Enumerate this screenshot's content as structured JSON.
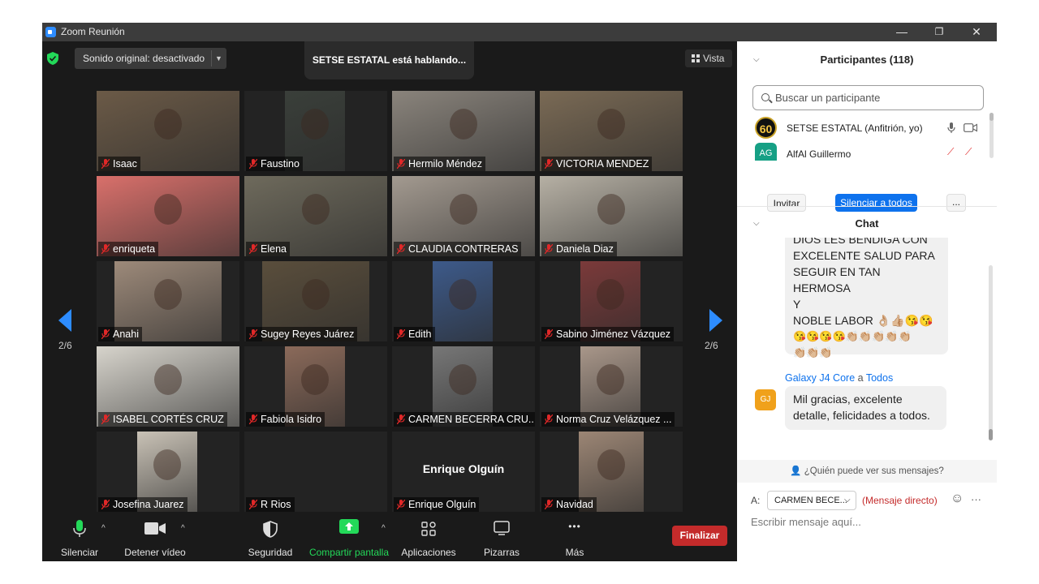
{
  "window": {
    "title": "Zoom Reunión",
    "minimize": "—",
    "restore": "❐",
    "close": "✕"
  },
  "topbar": {
    "sound": "Sonido original: desactivado",
    "speaking": "SETSE ESTATAL está hablando...",
    "view": "Vista"
  },
  "gallery": {
    "page_left": "2/6",
    "page_right": "2/6",
    "tiles": [
      {
        "name": "Isaac",
        "bg": "#6b5a47"
      },
      {
        "name": "Faustino",
        "bg": "#3a3f3a"
      },
      {
        "name": "Hermilo Méndez",
        "bg": "#8a847c"
      },
      {
        "name": "VICTORIA MENDEZ",
        "bg": "#7a6a55"
      },
      {
        "name": "enriqueta",
        "bg": "#d9706b"
      },
      {
        "name": "Elena",
        "bg": "#6e6a5c"
      },
      {
        "name": "CLAUDIA CONTRERAS",
        "bg": "#a39a90"
      },
      {
        "name": "Daniela Diaz",
        "bg": "#b6b0a4"
      },
      {
        "name": "Anahi",
        "bg": "#9d8a7a"
      },
      {
        "name": "Sugey Reyes Juárez",
        "bg": "#5a4e3c"
      },
      {
        "name": "Edith",
        "bg": "#3d5a8a"
      },
      {
        "name": "Sabino Jiménez Vázquez",
        "bg": "#7b3a3a"
      },
      {
        "name": "ISABEL CORTÉS CRUZ",
        "bg": "#d7d4cc"
      },
      {
        "name": "Fabiola Isidro",
        "bg": "#8b6a5a"
      },
      {
        "name": "CARMEN BECERRA CRU...",
        "bg": "#777"
      },
      {
        "name": "Norma Cruz Velázquez ...",
        "bg": "#a9978a"
      },
      {
        "name": "Josefina Juarez",
        "bg": "#c9c2b6"
      },
      {
        "name": "R Rios",
        "bg": "#232323"
      },
      {
        "name": "Enrique Olguín",
        "bg": "#232323",
        "center": "Enrique Olguín"
      },
      {
        "name": "Navidad",
        "bg": "#9c8675"
      }
    ]
  },
  "toolbar": {
    "mute": "Silenciar",
    "video": "Detener vídeo",
    "security": "Seguridad",
    "share": "Compartir pantalla",
    "apps": "Aplicaciones",
    "whiteboard": "Pizarras",
    "more": "Más",
    "end": "Finalizar",
    "more_dots": "•••",
    "caret": "^"
  },
  "participants": {
    "header": "Participantes (118)",
    "search_placeholder": "Buscar un participante",
    "list": [
      {
        "avatar": "60",
        "name": "SETSE ESTATAL (Anfitrión, yo)"
      },
      {
        "avatar": "AG",
        "name": "AlfAl Guillermo"
      }
    ],
    "invite": "Invitar",
    "mute_all": "Silenciar a todos",
    "more": "..."
  },
  "chat": {
    "header": "Chat",
    "message1": {
      "lines": [
        "DIOS LES BENDIGA CON",
        "EXCELENTE SALUD PARA",
        "SEGUIR EN TAN HERMOSA",
        "Y",
        "NOBLE LABOR 👌🏼👍🏼😘😘",
        "😘😘😘😘👏🏼👏🏼👏🏼👏🏼👏🏼",
        "👏🏼👏🏼👏🏼"
      ]
    },
    "message2": {
      "sender": "Galaxy J4 Core",
      "to_word": "a",
      "to": "Todos",
      "avatar": "GJ",
      "text": "Mil gracias, excelente detalle, felicidades a todos."
    },
    "who_can_see": "¿Quién puede ver sus mensajes?",
    "to_label": "A:",
    "recipient": "CARMEN BECE...",
    "direct": "(Mensaje directo)",
    "input_placeholder": "Escribir mensaje aquí...",
    "emoji_icon": "☺",
    "more": "···"
  },
  "colors": {
    "accent": "#2d8cff",
    "end": "#c42b2b",
    "share": "#23d959",
    "direct": "#c42b2b"
  }
}
